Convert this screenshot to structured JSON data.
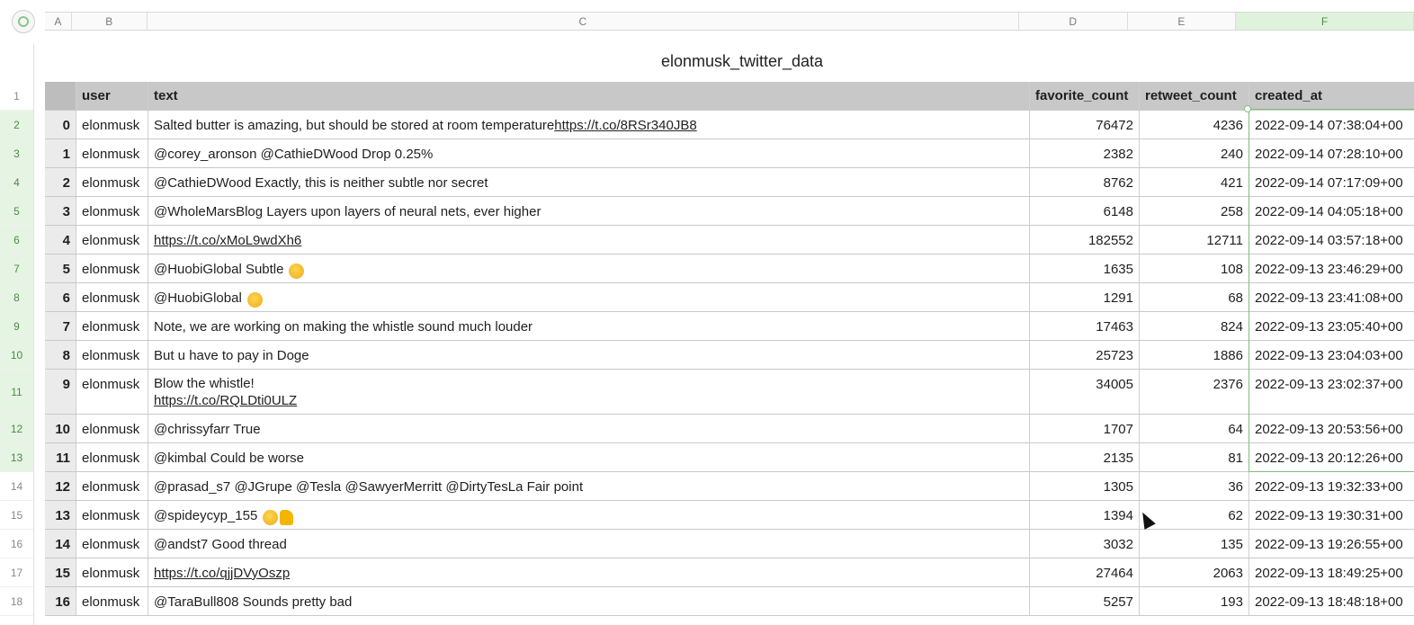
{
  "column_letters": [
    "A",
    "B",
    "C",
    "D",
    "E",
    "F"
  ],
  "selected_column": "F",
  "row_numbers": [
    "1",
    "2",
    "3",
    "4",
    "5",
    "6",
    "7",
    "8",
    "9",
    "10",
    "11",
    "12",
    "13",
    "14",
    "15",
    "16",
    "17",
    "18"
  ],
  "selected_rows": [
    "2",
    "3",
    "4",
    "5",
    "6",
    "7",
    "8",
    "9",
    "10",
    "11",
    "12",
    "13"
  ],
  "sheet_title": "elonmusk_twitter_data",
  "table": {
    "headers": [
      "",
      "user",
      "text",
      "favorite_count",
      "retweet_count",
      "created_at"
    ],
    "rows": [
      {
        "idx": "0",
        "user": "elonmusk",
        "text": "Salted butter is amazing, but should be stored at room temperature ",
        "link": "https://t.co/8RSr340JB8",
        "fav": "76472",
        "rt": "4236",
        "created": "2022-09-14 07:38:04+00"
      },
      {
        "idx": "1",
        "user": "elonmusk",
        "text": "@corey_aronson @CathieDWood Drop 0.25%",
        "fav": "2382",
        "rt": "240",
        "created": "2022-09-14 07:28:10+00"
      },
      {
        "idx": "2",
        "user": "elonmusk",
        "text": "@CathieDWood Exactly, this is neither subtle nor secret",
        "fav": "8762",
        "rt": "421",
        "created": "2022-09-14 07:17:09+00"
      },
      {
        "idx": "3",
        "user": "elonmusk",
        "text": "@WholeMarsBlog Layers upon layers of neural nets, ever higher",
        "fav": "6148",
        "rt": "258",
        "created": "2022-09-14 04:05:18+00"
      },
      {
        "idx": "4",
        "user": "elonmusk",
        "text": "",
        "link": "https://t.co/xMoL9wdXh6",
        "fav": "182552",
        "rt": "12711",
        "created": "2022-09-14 03:57:18+00"
      },
      {
        "idx": "5",
        "user": "elonmusk",
        "text": "@HuobiGlobal Subtle",
        "emoji": "winking-face-tongue-emoji",
        "fav": "1635",
        "rt": "108",
        "created": "2022-09-13 23:46:29+00"
      },
      {
        "idx": "6",
        "user": "elonmusk",
        "text": "@HuobiGlobal",
        "emoji": "winking-face-tongue-emoji",
        "fav": "1291",
        "rt": "68",
        "created": "2022-09-13 23:41:08+00"
      },
      {
        "idx": "7",
        "user": "elonmusk",
        "text": "Note, we are working on making the whistle sound much louder",
        "fav": "17463",
        "rt": "824",
        "created": "2022-09-13 23:05:40+00"
      },
      {
        "idx": "8",
        "user": "elonmusk",
        "text": "But u have to pay in Doge",
        "fav": "25723",
        "rt": "1886",
        "created": "2022-09-13 23:04:03+00"
      },
      {
        "idx": "9",
        "user": "elonmusk",
        "text": "Blow the whistle!",
        "link": "https://t.co/RQLDti0ULZ",
        "multiline": true,
        "fav": "34005",
        "rt": "2376",
        "created": "2022-09-13 23:02:37+00"
      },
      {
        "idx": "10",
        "user": "elonmusk",
        "text": "@chrissyfarr True",
        "fav": "1707",
        "rt": "64",
        "created": "2022-09-13 20:53:56+00"
      },
      {
        "idx": "11",
        "user": "elonmusk",
        "text": "@kimbal Could be worse",
        "fav": "2135",
        "rt": "81",
        "created": "2022-09-13 20:12:26+00"
      },
      {
        "idx": "12",
        "user": "elonmusk",
        "text": "@prasad_s7 @JGrupe @Tesla @SawyerMerritt @DirtyTesLa Fair point",
        "fav": "1305",
        "rt": "36",
        "created": "2022-09-13 19:32:33+00"
      },
      {
        "idx": "13",
        "user": "elonmusk",
        "text": "@spideycyp_155",
        "emoji": "winking-face-tongue-emoji",
        "thumb": "thumbs-up-emoji",
        "fav": "1394",
        "rt": "62",
        "created": "2022-09-13 19:30:31+00"
      },
      {
        "idx": "14",
        "user": "elonmusk",
        "text": "@andst7 Good thread",
        "fav": "3032",
        "rt": "135",
        "created": "2022-09-13 19:26:55+00"
      },
      {
        "idx": "15",
        "user": "elonmusk",
        "text": "",
        "link": "https://t.co/qjjDVyOszp",
        "fav": "27464",
        "rt": "2063",
        "created": "2022-09-13 18:49:25+00"
      },
      {
        "idx": "16",
        "user": "elonmusk",
        "text": "@TaraBull808 Sounds pretty bad",
        "fav": "5257",
        "rt": "193",
        "created": "2022-09-13 18:48:18+00"
      }
    ]
  }
}
